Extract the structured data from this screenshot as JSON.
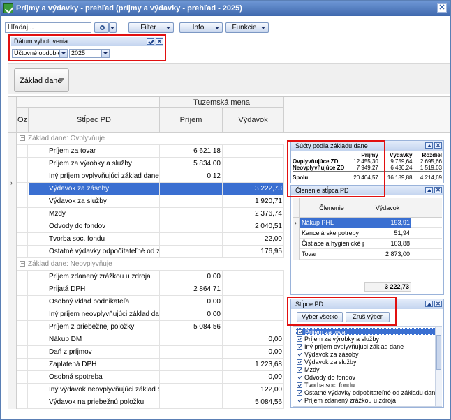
{
  "window": {
    "title": "Príjmy a výdavky - prehľad (príjmy a výdavky - prehľad - 2025)",
    "close": "✕"
  },
  "toolbar": {
    "search_placeholder": "Hľadaj...",
    "filter": "Filter",
    "info": "Info",
    "funkcie": "Funkcie"
  },
  "date_filter": {
    "title": "Dátum vyhotovenia",
    "period_label": "Účtovné obdobie",
    "year": "2025"
  },
  "group_button": {
    "label": "Základ dane"
  },
  "grid": {
    "header_group": "Tuzemská mena",
    "col_oz": "Oz",
    "col_name": "Stĺpec PD",
    "col_income": "Príjem",
    "col_expense": "Výdavok",
    "groups": [
      {
        "label": "Základ dane: Ovplyvňuje",
        "rows": [
          {
            "name": "Príjem za tovar",
            "income": "6 621,18",
            "expense": ""
          },
          {
            "name": "Príjem za výrobky a služby",
            "income": "5 834,00",
            "expense": ""
          },
          {
            "name": "Iný príjem ovplyvňujúci základ dane",
            "income": "0,12",
            "expense": ""
          },
          {
            "name": "Výdavok za zásoby",
            "income": "",
            "expense": "3 222,73",
            "selected": true
          },
          {
            "name": "Výdavok za služby",
            "income": "",
            "expense": "1 920,71"
          },
          {
            "name": "Mzdy",
            "income": "",
            "expense": "2 376,74"
          },
          {
            "name": "Odvody do fondov",
            "income": "",
            "expense": "2 040,51"
          },
          {
            "name": "Tvorba soc. fondu",
            "income": "",
            "expense": "22,00"
          },
          {
            "name": "Ostatné výdavky odpočítateľné od zákl",
            "income": "",
            "expense": "176,95"
          }
        ]
      },
      {
        "label": "Základ dane: Neovplyvňuje",
        "rows": [
          {
            "name": "Príjem zdanený zrážkou u zdroja",
            "income": "0,00",
            "expense": ""
          },
          {
            "name": "Prijatá DPH",
            "income": "2 864,71",
            "expense": ""
          },
          {
            "name": "Osobný vklad podnikateľa",
            "income": "0,00",
            "expense": ""
          },
          {
            "name": "Iný príjem neovplyvňujúci základ dane",
            "income": "0,00",
            "expense": ""
          },
          {
            "name": "Príjem z priebežnej položky",
            "income": "5 084,56",
            "expense": ""
          },
          {
            "name": "Nákup DM",
            "income": "",
            "expense": "0,00"
          },
          {
            "name": "Daň z príjmov",
            "income": "",
            "expense": "0,00"
          },
          {
            "name": "Zaplatená DPH",
            "income": "",
            "expense": "1 223,68"
          },
          {
            "name": "Osobná spotreba",
            "income": "",
            "expense": "0,00"
          },
          {
            "name": "Iný výdavok neovplyvňujúci základ da",
            "income": "",
            "expense": "122,00"
          },
          {
            "name": "Výdavok na priebežnú položku",
            "income": "",
            "expense": "5 084,56"
          }
        ]
      }
    ]
  },
  "sums_panel": {
    "title": "Súčty podľa základu dane",
    "headers": [
      "Príjmy",
      "Výdavky",
      "Rozdiel"
    ],
    "rows": [
      {
        "label": "Ovplyvňujúce ZD",
        "prijmy": "12 455,30",
        "vydavky": "9 759,64",
        "rozdiel": "2 695,66"
      },
      {
        "label": "Neovplyvňujúce ZD",
        "prijmy": "7 949,27",
        "vydavky": "6 430,24",
        "rozdiel": "1 519,03"
      },
      {
        "label": "Spolu",
        "prijmy": "20 404,57",
        "vydavky": "16 189,88",
        "rozdiel": "4 214,69"
      }
    ]
  },
  "clenenie_panel": {
    "title": "Členenie stĺpca PD",
    "col_name": "Členenie",
    "col_value": "Výdavok",
    "rows": [
      {
        "name": "Nákup PHL",
        "value": "193,91",
        "selected": true
      },
      {
        "name": "Kancelárske potreby",
        "value": "51,94"
      },
      {
        "name": "Čistiace a hygienické pro",
        "value": "103,88"
      },
      {
        "name": "Tovar",
        "value": "2 873,00"
      }
    ],
    "total": "3 222,73"
  },
  "stlpce_panel": {
    "title": "Stĺpce PD",
    "select_all": "Vyber všetko",
    "clear": "Zruš výber",
    "items": [
      "Príjem za tovar",
      "Príjem za výrobky a služby",
      "Iný príjem ovplyvňujúci základ dane",
      "Výdavok za zásoby",
      "Výdavok za služby",
      "Mzdy",
      "Odvody do fondov",
      "Tvorba soc. fondu",
      "Ostatné výdavky odpočítateľné od základu dane",
      "Príjem zdanený zrážkou u zdroja"
    ]
  },
  "colors": {
    "accent": "#3a6fd1",
    "highlight_box": "#e11010",
    "title_bar": "#4f78bd"
  }
}
